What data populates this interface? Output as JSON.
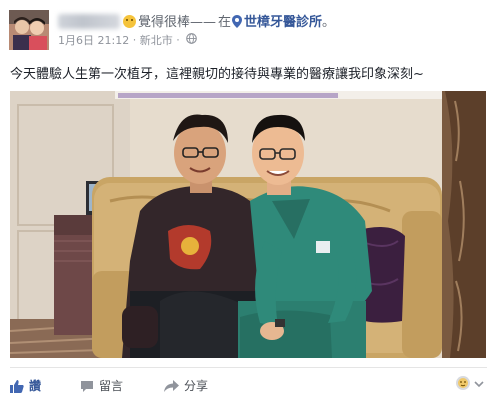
{
  "post": {
    "author_name_redacted": true,
    "feeling_text": "覺得很棒",
    "dash": "——",
    "at_text": "在",
    "page_name": "世樟牙醫診所",
    "trailing_dot": "。",
    "date": "1月6日 21:12",
    "location": "新北市",
    "separator": "·",
    "privacy_icon": "globe-icon",
    "body_text": "今天體驗人生第一次植牙，這裡親切的接待與專業的醫療讓我印象深刻~"
  },
  "actions": {
    "like_label": "讚",
    "comment_label": "留言",
    "share_label": "分享",
    "reaction_icon": "reaction-selector-icon"
  },
  "colors": {
    "link": "#365899",
    "meta": "#90949c",
    "text": "#1d2129",
    "like_blue": "#4267b2",
    "scrubs_green": "#2f8a7a"
  }
}
